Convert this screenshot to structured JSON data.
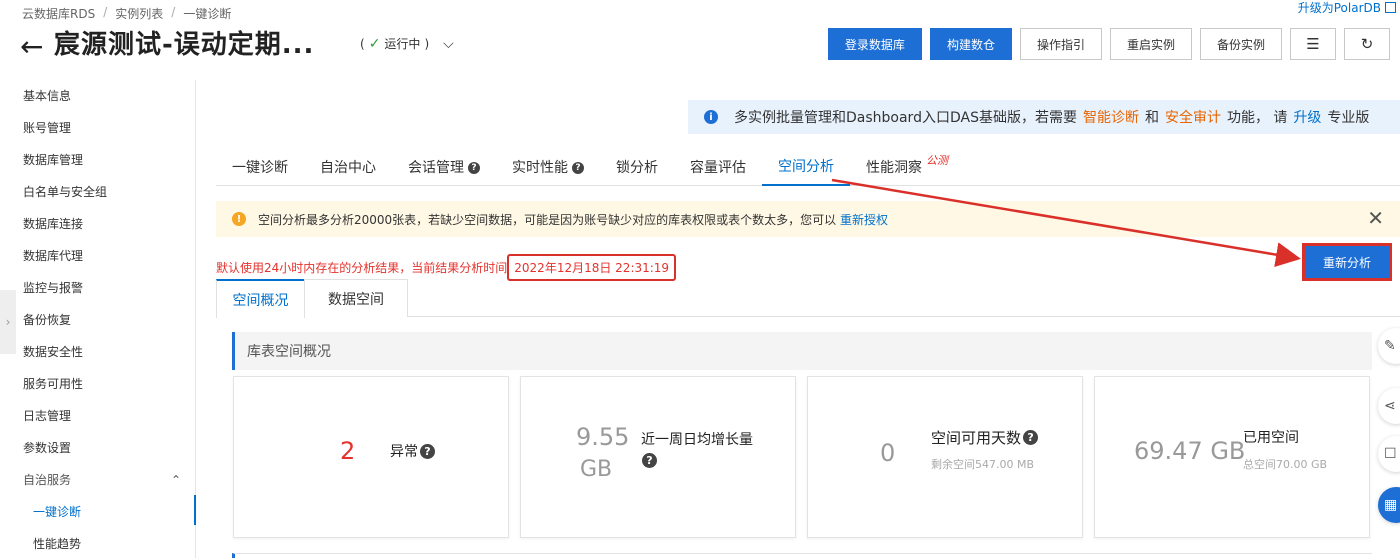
{
  "breadcrumb": [
    "云数据库RDS",
    "实例列表",
    "一键诊断"
  ],
  "upgrade_link": "升级为PolarDB",
  "page_title": "宸源测试-误动定期...",
  "status": "运行中",
  "header_buttons": {
    "login_db": "登录数据库",
    "build_dw": "构建数仓",
    "guide": "操作指引",
    "restart": "重启实例",
    "backup": "备份实例"
  },
  "sidebar": {
    "items": [
      "基本信息",
      "账号管理",
      "数据库管理",
      "白名单与安全组",
      "数据库连接",
      "数据库代理",
      "监控与报警",
      "备份恢复",
      "数据安全性",
      "服务可用性",
      "日志管理",
      "参数设置"
    ],
    "group": "自治服务",
    "sub_items": [
      "一键诊断",
      "性能趋势"
    ]
  },
  "das_banner": {
    "text1": "多实例批量管理和Dashboard入口DAS基础版，若需要",
    "hl1": "智能诊断",
    "and": "和",
    "hl2": "安全审计",
    "text2": "功能，  请",
    "link": "升级",
    "text3": "专业版"
  },
  "tabs": [
    "一键诊断",
    "自治中心",
    "会话管理",
    "实时性能",
    "锁分析",
    "容量评估",
    "空间分析",
    "性能洞察"
  ],
  "beta_label": "公测",
  "warning": {
    "text": "空间分析最多分析20000张表，若缺少空间数据，可能是因为账号缺少对应的库表权限或表个数太多，您可以",
    "link": "重新授权"
  },
  "analysis_info": "默认使用24小时内存在的分析结果，当前结果分析时间",
  "analysis_time": "2022年12月18日 22:31:19",
  "reanalyze_button": "重新分析",
  "subtabs": [
    "空间概况",
    "数据空间"
  ],
  "panel_title": "库表空间概况",
  "cards": {
    "abnormal": {
      "value": "2",
      "label": "异常"
    },
    "growth": {
      "value_num": "9.55",
      "value_unit": "GB",
      "label": "近一周日均增长量"
    },
    "days": {
      "value": "0",
      "label": "空间可用天数",
      "sub": "剩余空间547.00 MB"
    },
    "used": {
      "value": "69.47 GB",
      "label": "已用空间",
      "sub": "总空间70.00 GB"
    }
  },
  "colors": {
    "primary": "#1d6fd6",
    "highlight_red": "#d9302a",
    "orange": "#e86400"
  }
}
